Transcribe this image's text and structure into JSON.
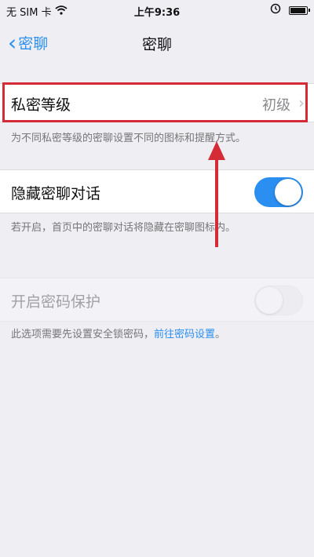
{
  "status": {
    "carrier": "无 SIM 卡",
    "time": "上午9:36"
  },
  "nav": {
    "back_label": "密聊",
    "title": "密聊"
  },
  "privacy_level": {
    "label": "私密等级",
    "value": "初级",
    "note": "为不同私密等级的密聊设置不同的图标和提醒方式。"
  },
  "hide_chat": {
    "label": "隐藏密聊对话",
    "enabled": true,
    "note": "若开启，首页中的密聊对话将隐藏在密聊图标内。"
  },
  "password_protect": {
    "label": "开启密码保护",
    "enabled": false,
    "note_prefix": "此选项需要先设置安全锁密码，",
    "note_link": "前往密码设置",
    "note_suffix": "。"
  },
  "colors": {
    "accent": "#2a8ff0",
    "highlight": "#d42b36"
  },
  "icons": [
    "wifi-icon",
    "alarm-icon",
    "battery-icon",
    "chevron-left-icon",
    "chevron-right-icon"
  ]
}
